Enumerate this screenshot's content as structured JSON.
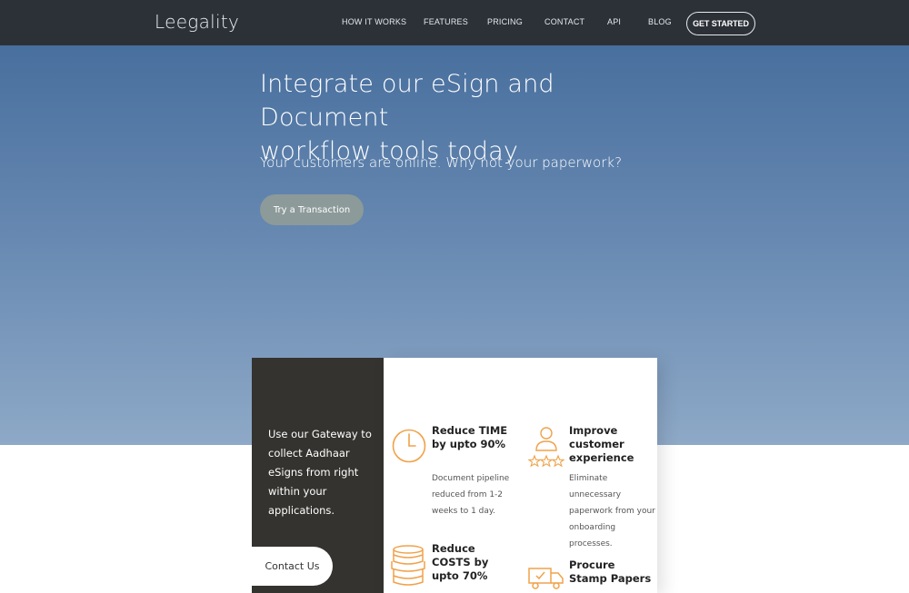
{
  "nav": {
    "logo": "Leegality",
    "links": [
      "HOW IT WORKS",
      "FEATURES",
      "PRICING",
      "CONTACT",
      "API",
      "BLOG"
    ],
    "cta": "GET STARTED"
  },
  "hero": {
    "title_line1": "Integrate our eSign and Document",
    "title_line2": "workflow tools today",
    "subtitle": "Your customers are online. Why not your paperwork?",
    "button": "Try a Transaction"
  },
  "gateway": {
    "text": "Use our Gateway to collect Aadhaar eSigns from right within your applications.",
    "contact_button": "Contact Us"
  },
  "features": [
    {
      "title": "Reduce TIME by upto 90%",
      "desc": "Document pipeline reduced from 1-2 weeks to 1 day.",
      "icon": "clock-icon"
    },
    {
      "title": "Improve customer experience",
      "desc": "Eliminate unnecessary paperwork from your onboarding processes.",
      "icon": "customer-rating-icon"
    },
    {
      "title": "Reduce COSTS by upto 70%",
      "desc": "",
      "icon": "coins-icon"
    },
    {
      "title": "Procure Stamp Papers",
      "desc": "",
      "icon": "delivery-truck-icon"
    }
  ],
  "colors": {
    "nav_bg": "#2c3138",
    "hero_top": "#486f9e",
    "hero_bottom": "#8ea9c7",
    "card_dark": "#34332f",
    "accent_icon": "#f0a24a"
  }
}
